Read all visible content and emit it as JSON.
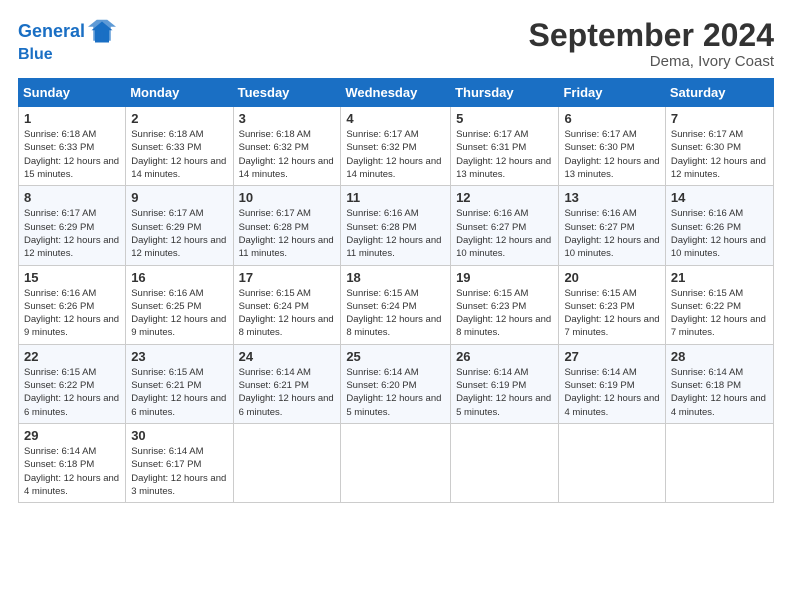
{
  "header": {
    "logo_line1": "General",
    "logo_line2": "Blue",
    "month_title": "September 2024",
    "location": "Dema, Ivory Coast"
  },
  "days_of_week": [
    "Sunday",
    "Monday",
    "Tuesday",
    "Wednesday",
    "Thursday",
    "Friday",
    "Saturday"
  ],
  "weeks": [
    [
      {
        "day": "1",
        "sunrise": "6:18 AM",
        "sunset": "6:33 PM",
        "daylight": "12 hours and 15 minutes."
      },
      {
        "day": "2",
        "sunrise": "6:18 AM",
        "sunset": "6:33 PM",
        "daylight": "12 hours and 14 minutes."
      },
      {
        "day": "3",
        "sunrise": "6:18 AM",
        "sunset": "6:32 PM",
        "daylight": "12 hours and 14 minutes."
      },
      {
        "day": "4",
        "sunrise": "6:17 AM",
        "sunset": "6:32 PM",
        "daylight": "12 hours and 14 minutes."
      },
      {
        "day": "5",
        "sunrise": "6:17 AM",
        "sunset": "6:31 PM",
        "daylight": "12 hours and 13 minutes."
      },
      {
        "day": "6",
        "sunrise": "6:17 AM",
        "sunset": "6:30 PM",
        "daylight": "12 hours and 13 minutes."
      },
      {
        "day": "7",
        "sunrise": "6:17 AM",
        "sunset": "6:30 PM",
        "daylight": "12 hours and 12 minutes."
      }
    ],
    [
      {
        "day": "8",
        "sunrise": "6:17 AM",
        "sunset": "6:29 PM",
        "daylight": "12 hours and 12 minutes."
      },
      {
        "day": "9",
        "sunrise": "6:17 AM",
        "sunset": "6:29 PM",
        "daylight": "12 hours and 12 minutes."
      },
      {
        "day": "10",
        "sunrise": "6:17 AM",
        "sunset": "6:28 PM",
        "daylight": "12 hours and 11 minutes."
      },
      {
        "day": "11",
        "sunrise": "6:16 AM",
        "sunset": "6:28 PM",
        "daylight": "12 hours and 11 minutes."
      },
      {
        "day": "12",
        "sunrise": "6:16 AM",
        "sunset": "6:27 PM",
        "daylight": "12 hours and 10 minutes."
      },
      {
        "day": "13",
        "sunrise": "6:16 AM",
        "sunset": "6:27 PM",
        "daylight": "12 hours and 10 minutes."
      },
      {
        "day": "14",
        "sunrise": "6:16 AM",
        "sunset": "6:26 PM",
        "daylight": "12 hours and 10 minutes."
      }
    ],
    [
      {
        "day": "15",
        "sunrise": "6:16 AM",
        "sunset": "6:26 PM",
        "daylight": "12 hours and 9 minutes."
      },
      {
        "day": "16",
        "sunrise": "6:16 AM",
        "sunset": "6:25 PM",
        "daylight": "12 hours and 9 minutes."
      },
      {
        "day": "17",
        "sunrise": "6:15 AM",
        "sunset": "6:24 PM",
        "daylight": "12 hours and 8 minutes."
      },
      {
        "day": "18",
        "sunrise": "6:15 AM",
        "sunset": "6:24 PM",
        "daylight": "12 hours and 8 minutes."
      },
      {
        "day": "19",
        "sunrise": "6:15 AM",
        "sunset": "6:23 PM",
        "daylight": "12 hours and 8 minutes."
      },
      {
        "day": "20",
        "sunrise": "6:15 AM",
        "sunset": "6:23 PM",
        "daylight": "12 hours and 7 minutes."
      },
      {
        "day": "21",
        "sunrise": "6:15 AM",
        "sunset": "6:22 PM",
        "daylight": "12 hours and 7 minutes."
      }
    ],
    [
      {
        "day": "22",
        "sunrise": "6:15 AM",
        "sunset": "6:22 PM",
        "daylight": "12 hours and 6 minutes."
      },
      {
        "day": "23",
        "sunrise": "6:15 AM",
        "sunset": "6:21 PM",
        "daylight": "12 hours and 6 minutes."
      },
      {
        "day": "24",
        "sunrise": "6:14 AM",
        "sunset": "6:21 PM",
        "daylight": "12 hours and 6 minutes."
      },
      {
        "day": "25",
        "sunrise": "6:14 AM",
        "sunset": "6:20 PM",
        "daylight": "12 hours and 5 minutes."
      },
      {
        "day": "26",
        "sunrise": "6:14 AM",
        "sunset": "6:19 PM",
        "daylight": "12 hours and 5 minutes."
      },
      {
        "day": "27",
        "sunrise": "6:14 AM",
        "sunset": "6:19 PM",
        "daylight": "12 hours and 4 minutes."
      },
      {
        "day": "28",
        "sunrise": "6:14 AM",
        "sunset": "6:18 PM",
        "daylight": "12 hours and 4 minutes."
      }
    ],
    [
      {
        "day": "29",
        "sunrise": "6:14 AM",
        "sunset": "6:18 PM",
        "daylight": "12 hours and 4 minutes."
      },
      {
        "day": "30",
        "sunrise": "6:14 AM",
        "sunset": "6:17 PM",
        "daylight": "12 hours and 3 minutes."
      },
      null,
      null,
      null,
      null,
      null
    ]
  ],
  "labels": {
    "sunrise": "Sunrise:",
    "sunset": "Sunset:",
    "daylight": "Daylight:"
  }
}
